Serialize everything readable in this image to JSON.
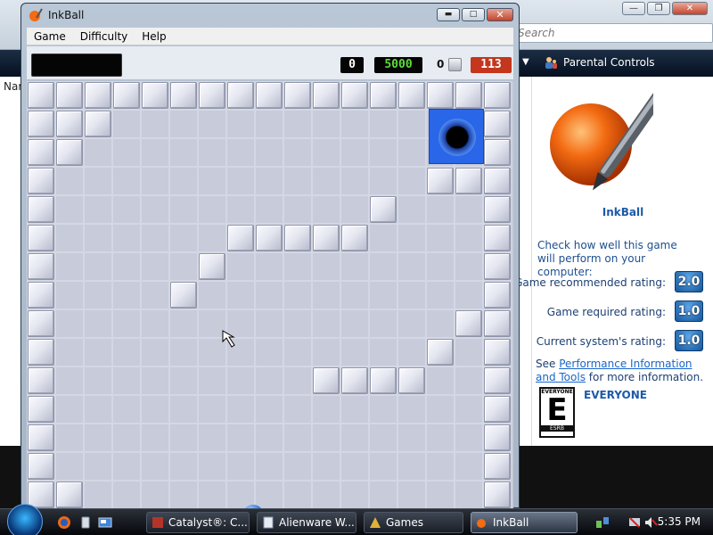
{
  "background": {
    "search_placeholder": "Search",
    "nav_partial": "Nar",
    "parental_controls": "Parental Controls",
    "details": {
      "game_name": "InkBall",
      "perf_intro": "Check how well this game will perform on your computer:",
      "ratings": [
        {
          "label": "Game recommended rating:",
          "value": "2.0"
        },
        {
          "label": "Game required rating:",
          "value": "1.0"
        },
        {
          "label": "Current system's rating:",
          "value": "1.0"
        }
      ],
      "see_prefix": "See ",
      "see_link": "Performance Information and Tools",
      "see_suffix": " for more information.",
      "esrb_top": "EVERYONE",
      "esrb_letter": "E",
      "esrb_bottom": "ESRB",
      "esrb_rating": "EVERYONE"
    }
  },
  "inkball": {
    "title": "InkBall",
    "menu": [
      "Game",
      "Difficulty",
      "Help"
    ],
    "message": "",
    "score": "0",
    "target_score": "5000",
    "gray_balls_captured": "0",
    "time_remaining": "113",
    "colors": {
      "hole": "#2a66e8",
      "ball": "#1b6fe0",
      "timer": "#c4361d",
      "target_score": "#5ddc3a"
    }
  },
  "taskbar": {
    "buttons": [
      {
        "label": "Catalyst®: C...",
        "icon": "catalyst-icon"
      },
      {
        "label": "Alienware W...",
        "icon": "document-icon"
      },
      {
        "label": "Games",
        "icon": "games-icon"
      },
      {
        "label": "InkBall",
        "icon": "inkball-icon",
        "active": true
      }
    ],
    "clock": "5:35 PM"
  }
}
